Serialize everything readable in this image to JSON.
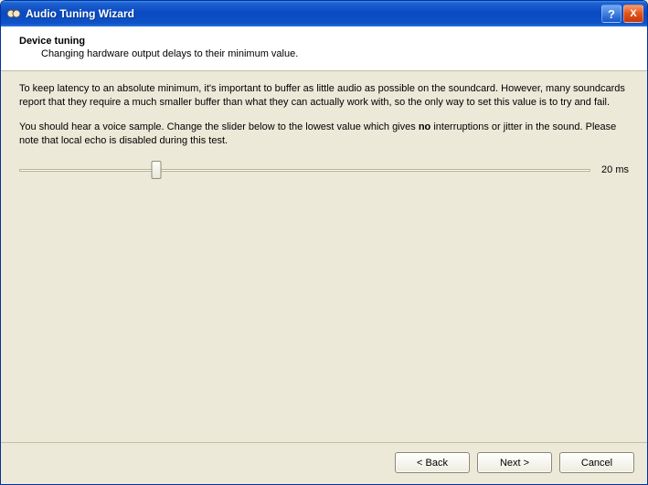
{
  "window": {
    "title": "Audio Tuning Wizard"
  },
  "header": {
    "heading": "Device tuning",
    "subheading": "Changing hardware output delays to their minimum value."
  },
  "body": {
    "para1": "To keep latency to an absolute minimum, it's important to buffer as little audio as possible on the soundcard. However, many soundcards report that they require a much smaller buffer than what they can actually work with, so the only way to set this value is to try and fail.",
    "para2_pre": "You should hear a voice sample. Change the slider below to the lowest value which gives ",
    "para2_bold": "no",
    "para2_post": " interruptions or jitter in the sound. Please note that local echo is disabled during this test."
  },
  "slider": {
    "value_label": "20 ms",
    "position_percent": 24
  },
  "buttons": {
    "back": "< Back",
    "next": "Next >",
    "cancel": "Cancel"
  },
  "titlebar_buttons": {
    "help": "?",
    "close": "X"
  }
}
